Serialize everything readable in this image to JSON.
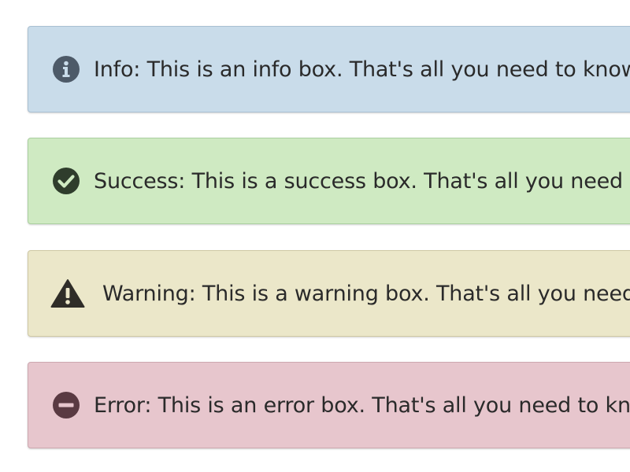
{
  "alerts": [
    {
      "type": "info",
      "icon": "info-circle-icon",
      "text": "Info: This is an info box. That's all you need to know.",
      "background": "#c9dcea",
      "icon_color": "#4d5a68"
    },
    {
      "type": "success",
      "icon": "check-circle-icon",
      "text": "Success: This is a success box. That's all you need to know.",
      "background": "#cfeac2",
      "icon_color": "#2f3d2c"
    },
    {
      "type": "warning",
      "icon": "warning-triangle-icon",
      "text": "Warning: This is a warning box. That's all you need to know.",
      "background": "#ebe7c9",
      "icon_color": "#2f2d28"
    },
    {
      "type": "error",
      "icon": "minus-circle-icon",
      "text": "Error: This is an error box. That's all you need to know.",
      "background": "#e7c6cd",
      "icon_color": "#5a3a42"
    }
  ]
}
